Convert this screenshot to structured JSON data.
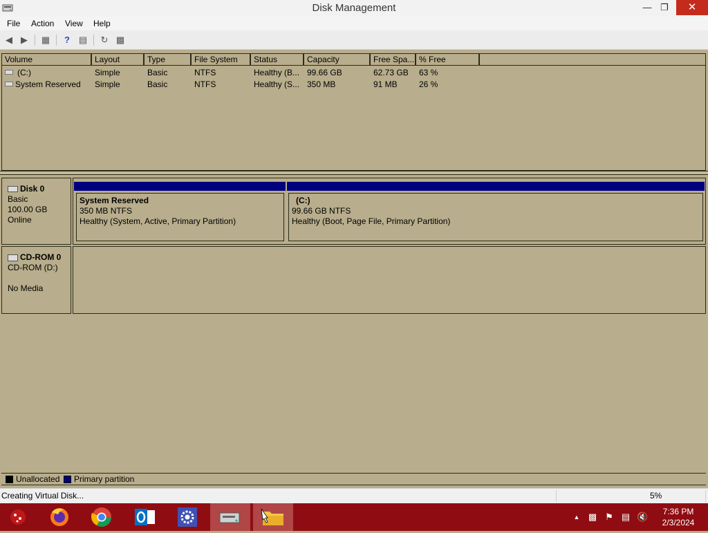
{
  "window": {
    "title": "Disk Management"
  },
  "menu": [
    "File",
    "Action",
    "View",
    "Help"
  ],
  "volume_table": {
    "columns": [
      "Volume",
      "Layout",
      "Type",
      "File System",
      "Status",
      "Capacity",
      "Free Spa...",
      "% Free"
    ],
    "rows": [
      [
        "(C:)",
        "Simple",
        "Basic",
        "NTFS",
        "Healthy (B...",
        "99.66 GB",
        "62.73 GB",
        "63 %"
      ],
      [
        "System Reserved",
        "Simple",
        "Basic",
        "NTFS",
        "Healthy (S...",
        "350 MB",
        "91 MB",
        "26 %"
      ]
    ]
  },
  "disks": [
    {
      "name": "Disk 0",
      "type": "Basic",
      "size": "100.00 GB",
      "state": "Online",
      "partitions": [
        {
          "name": "System Reserved",
          "size": "350 MB NTFS",
          "status": "Healthy (System, Active, Primary Partition)"
        },
        {
          "name": "(C:)",
          "size": "99.66 GB NTFS",
          "status": "Healthy (Boot, Page File, Primary Partition)"
        }
      ]
    },
    {
      "name": "CD-ROM 0",
      "type": "CD-ROM (D:)",
      "media": "No Media"
    }
  ],
  "legend": [
    {
      "label": "Unallocated",
      "color": "#000000"
    },
    {
      "label": "Primary partition",
      "color": "#00007e"
    }
  ],
  "status": {
    "text": "Creating Virtual Disk...",
    "progress": "5%"
  },
  "taskbar": {
    "apps": [
      "game-icon",
      "firefox-icon",
      "chrome-icon",
      "outlook-icon",
      "settings-icon",
      "disk-management-icon",
      "file-explorer-icon"
    ],
    "time": "7:36 PM",
    "date": "2/3/2024"
  },
  "colors": {
    "panel": "#b8ad8c",
    "primary_partition": "#00007e",
    "taskbar": "#8f0d12"
  }
}
